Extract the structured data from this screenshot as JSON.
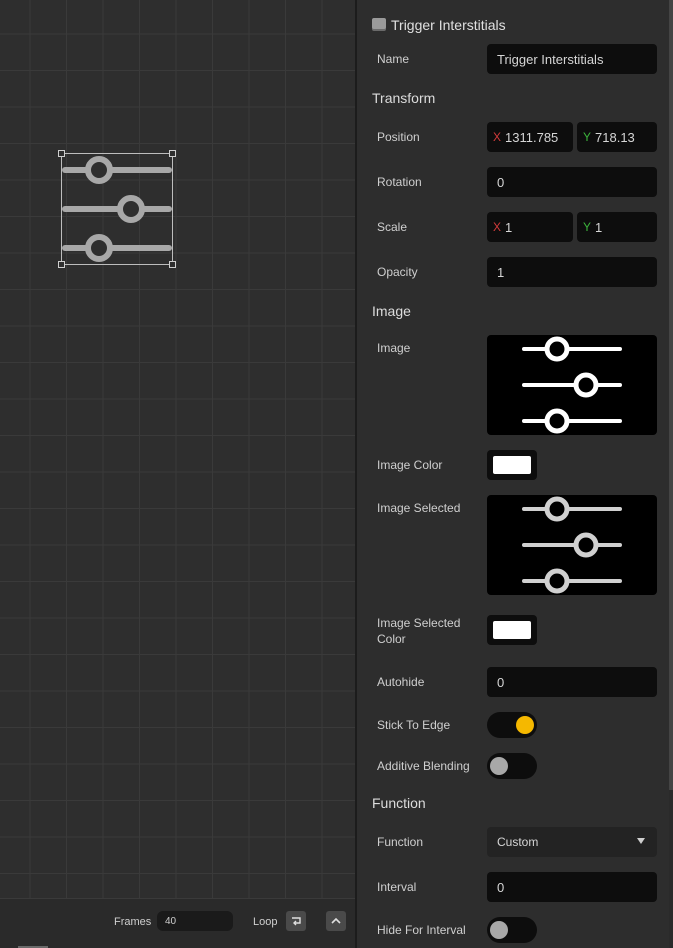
{
  "inspector": {
    "title": "Trigger Interstitials",
    "name_label": "Name",
    "name_value": "Trigger Interstitials",
    "transform": {
      "section": "Transform",
      "position_label": "Position",
      "position_x": "1311.785",
      "position_y": "718.13",
      "rotation_label": "Rotation",
      "rotation_value": "0",
      "scale_label": "Scale",
      "scale_x": "1",
      "scale_y": "1",
      "opacity_label": "Opacity",
      "opacity_value": "1"
    },
    "image": {
      "section": "Image",
      "image_label": "Image",
      "image_icon": "sliders-icon",
      "image_color_label": "Image Color",
      "image_color": "#ffffff",
      "image_selected_label": "Image Selected",
      "image_selected_icon": "sliders-icon",
      "image_selected_color_label": "Image Selected Color",
      "image_selected_color": "#ffffff",
      "autohide_label": "Autohide",
      "autohide_value": "0",
      "stick_to_edge_label": "Stick To Edge",
      "stick_to_edge_on": true,
      "additive_blending_label": "Additive Blending",
      "additive_blending_on": false
    },
    "function": {
      "section": "Function",
      "function_label": "Function",
      "function_value": "Custom",
      "interval_label": "Interval",
      "interval_value": "0",
      "hide_for_interval_label": "Hide For Interval",
      "hide_for_interval_on": false
    }
  },
  "timeline": {
    "frames_label": "Frames",
    "frames_value": "40",
    "loop_label": "Loop",
    "loop_icon": "loop-icon",
    "expand_icon": "chevron-up-icon"
  },
  "canvas": {
    "selected_element_icon": "sliders-icon"
  },
  "colors": {
    "accent_toggle_on": "#f5b800",
    "toggle_off_knob": "#a8a8a8",
    "axis_x": "#d23b3b",
    "axis_y": "#3bb33b"
  }
}
